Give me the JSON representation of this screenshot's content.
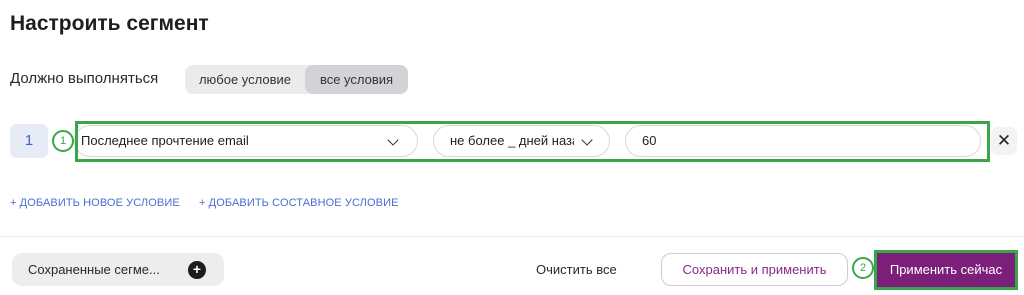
{
  "title": "Настроить сегмент",
  "must_execute": {
    "label": "Должно выполняться",
    "options": [
      "любое условие",
      "все условия"
    ],
    "selected": "все условия"
  },
  "condition": {
    "number": "1",
    "field": "Последнее прочтение email",
    "operator": "не более _ дней назад",
    "value": "60",
    "remove_symbol": "✕"
  },
  "annotations": {
    "badge1": "1",
    "badge2": "2",
    "color": "#3aa64a"
  },
  "links": {
    "add_condition": "+ ДОБАВИТЬ НОВОЕ УСЛОВИЕ",
    "add_compound": "+ ДОБАВИТЬ СОСТАВНОЕ УСЛОВИЕ"
  },
  "footer": {
    "saved_segments": "Сохраненные сегме...",
    "saved_plus": "+",
    "clear_all": "Очистить все",
    "save_apply": "Сохранить и применить",
    "apply_now": "Применить сейчас"
  },
  "colors": {
    "accent": "#7b1f7a",
    "link": "#4a6fd1",
    "highlight": "#3aa64a"
  },
  "icons": [
    "chevron-down-icon",
    "close-icon",
    "plus-circle-icon"
  ]
}
